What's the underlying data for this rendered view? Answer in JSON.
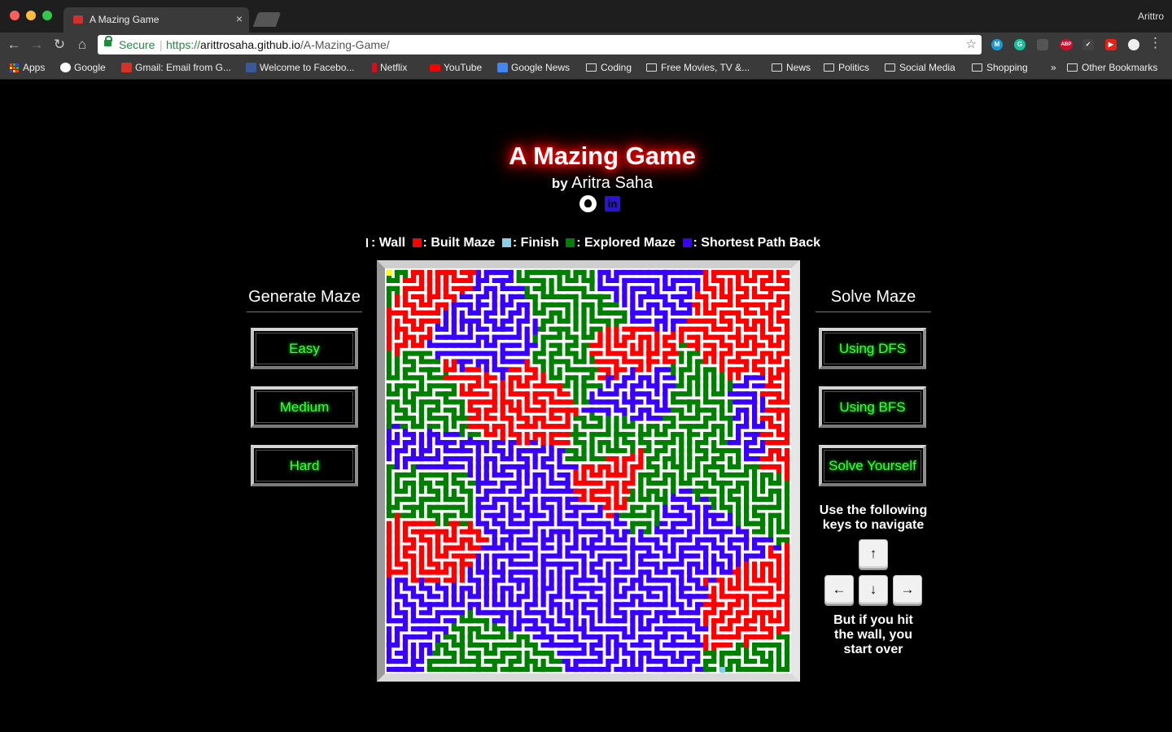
{
  "browser": {
    "tab_title": "A Mazing Game",
    "tab_close": "×",
    "profile": "Arittro",
    "secure_label": "Secure",
    "url_proto": "https://",
    "url_host": "arittrosaha.github.io",
    "url_path": "/A-Mazing-Game/",
    "bookmarks": [
      {
        "label": "Apps"
      },
      {
        "label": "Google"
      },
      {
        "label": "Gmail: Email from G..."
      },
      {
        "label": "Welcome to Facebo..."
      },
      {
        "label": "Netflix"
      },
      {
        "label": "YouTube"
      },
      {
        "label": "Google News"
      },
      {
        "label": "Coding"
      },
      {
        "label": "Free Movies, TV &..."
      },
      {
        "label": "News"
      },
      {
        "label": "Politics"
      },
      {
        "label": "Social Media"
      },
      {
        "label": "Shopping"
      },
      {
        "label": "»"
      },
      {
        "label": "Other Bookmarks"
      }
    ],
    "extensions": [
      "M",
      "G",
      "pocket",
      "ABP",
      "✓",
      "▶",
      "○"
    ]
  },
  "page": {
    "title": "A Mazing Game",
    "by": "by",
    "author": "Aritra Saha",
    "legend": {
      "wall": ": Wall",
      "built": ": Built Maze",
      "finish": ": Finish",
      "explored": ": Explored Maze",
      "shortest": ": Shortest Path Back"
    },
    "generate": {
      "heading": "Generate Maze",
      "buttons": [
        "Easy",
        "Medium",
        "Hard"
      ]
    },
    "solve": {
      "heading": "Solve Maze",
      "buttons": [
        "Using DFS",
        "Using BFS",
        "Solve Yourself"
      ],
      "hint_top": "Use the following keys to navigate",
      "hint_bottom": "But if you hit the wall, you start over"
    }
  },
  "colors": {
    "wall": "#ffffff",
    "built": "#ff0000",
    "finish": "#87ceeb",
    "explored": "#008000",
    "shortest": "#3a00ff",
    "start": "#ffff00",
    "button_text": "#3dff3d",
    "title_glow": "#ff0000"
  },
  "icons": {
    "github": "github-icon",
    "linkedin": "linkedin-icon",
    "key_up": "arrow-up-icon",
    "key_left": "arrow-left-icon",
    "key_down": "arrow-down-icon",
    "key_right": "arrow-right-icon"
  },
  "maze": {
    "size": 50,
    "regions": [
      {
        "name": "explored",
        "color": "#008000"
      },
      {
        "name": "built",
        "color": "#ff0000"
      },
      {
        "name": "shortest",
        "color": "#3a00ff"
      }
    ]
  }
}
